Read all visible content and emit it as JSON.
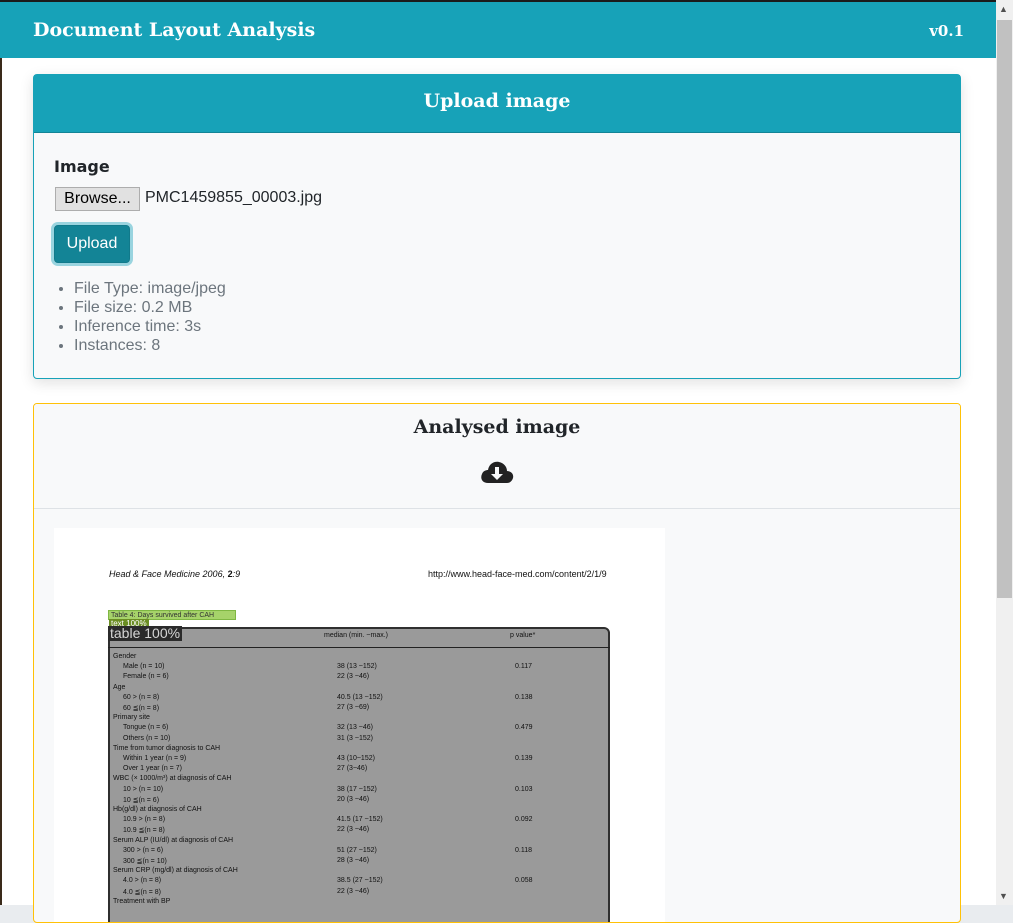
{
  "navbar": {
    "title": "Document Layout Analysis",
    "version": "v0.1"
  },
  "upload_card": {
    "header": "Upload image",
    "field_label": "Image",
    "browse_label": "Browse...",
    "filename": "PMC1459855_00003.jpg",
    "upload_label": "Upload",
    "info": [
      "File Type: image/jpeg",
      "File size: 0.2 MB",
      "Inference time: 3s",
      "Instances: 8"
    ]
  },
  "analysed_card": {
    "header": "Analysed image",
    "download_icon": "cloud-download-icon"
  },
  "document": {
    "journal": "Head & Face Medicine",
    "journal_ref": " 2006, ",
    "volume": "2",
    "page": ":9",
    "url": "http://www.head-face-med.com/content/2/1/9",
    "caption": "Table 4: Days survived after CAH",
    "text_label": "text 100%",
    "table_label": "table 100%",
    "col_median": "median (min. ~max.)",
    "col_p": "p value*",
    "rows": [
      {
        "label": "Gender",
        "median": "",
        "p": ""
      },
      {
        "label": "Male (n = 10)",
        "median": "38 (13 ~152)",
        "p": "0.117"
      },
      {
        "label": "Female (n = 6)",
        "median": "22 (3 ~46)",
        "p": ""
      },
      {
        "label": "Age",
        "median": "",
        "p": ""
      },
      {
        "label": "60 > (n = 8)",
        "median": "40.5 (13 ~152)",
        "p": "0.138"
      },
      {
        "label": "60 ≦(n = 8)",
        "median": "27 (3 ~69)",
        "p": ""
      },
      {
        "label": "Primary site",
        "median": "",
        "p": ""
      },
      {
        "label": "Tongue (n = 6)",
        "median": "32 (13 ~46)",
        "p": "0.479"
      },
      {
        "label": "Others (n = 10)",
        "median": "31 (3 ~152)",
        "p": ""
      },
      {
        "label": "Time from tumor diagnosis to CAH",
        "median": "",
        "p": ""
      },
      {
        "label": "Within 1 year (n = 9)",
        "median": "43 (10~152)",
        "p": "0.139"
      },
      {
        "label": "Over 1 year (n = 7)",
        "median": "27 (3~46)",
        "p": ""
      },
      {
        "label": "WBC (× 1000/m³) at diagnosis of CAH",
        "median": "",
        "p": ""
      },
      {
        "label": "10 > (n = 10)",
        "median": "38 (17 ~152)",
        "p": "0.103"
      },
      {
        "label": "10 ≦(n = 6)",
        "median": "20 (3 ~46)",
        "p": ""
      },
      {
        "label": "Hb(g/dl) at diagnosis of CAH",
        "median": "",
        "p": ""
      },
      {
        "label": "10.9 > (n = 8)",
        "median": "41.5 (17 ~152)",
        "p": "0.092"
      },
      {
        "label": "10.9 ≦(n = 8)",
        "median": "22 (3 ~46)",
        "p": ""
      },
      {
        "label": "Serum ALP (IU/dl) at diagnosis of CAH",
        "median": "",
        "p": ""
      },
      {
        "label": "300 > (n = 6)",
        "median": "51 (27 ~152)",
        "p": "0.118"
      },
      {
        "label": "300 ≦(n = 10)",
        "median": "28 (3 ~46)",
        "p": ""
      },
      {
        "label": "Serum CRP (mg/dl) at diagnosis of CAH",
        "median": "",
        "p": ""
      },
      {
        "label": "4.0 > (n = 8)",
        "median": "38.5 (27 ~152)",
        "p": "0.058"
      },
      {
        "label": "4.0 ≦(n = 8)",
        "median": "22 (3 ~46)",
        "p": ""
      },
      {
        "label": "Treatment with BP",
        "median": "",
        "p": ""
      }
    ]
  }
}
